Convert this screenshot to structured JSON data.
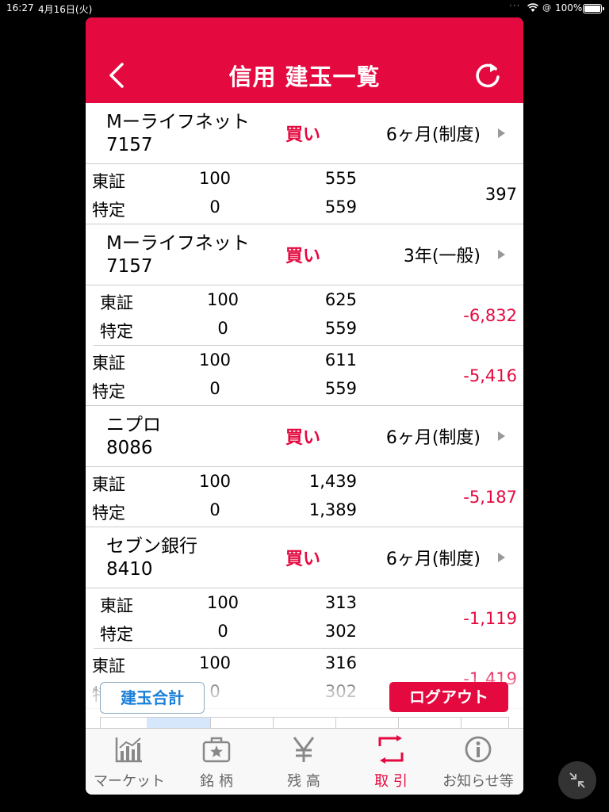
{
  "status_bar": {
    "time": "16:27",
    "date": "4月16日(火)",
    "battery": "100%"
  },
  "header": {
    "title": "信用 建玉一覧"
  },
  "holdings": [
    {
      "name": "Mーライフネット",
      "code": "7157",
      "side": "買い",
      "term": "6ヶ月(制度)",
      "rows": [
        {
          "market": "東証",
          "account": "特定",
          "qty": "100",
          "qty2": "0",
          "price": "555",
          "price2": "559",
          "pl": "397",
          "pl_sign": "pos"
        }
      ]
    },
    {
      "name": "Mーライフネット",
      "code": "7157",
      "side": "買い",
      "term": "3年(一般)",
      "rows": [
        {
          "market": "東証",
          "account": "特定",
          "qty": "100",
          "qty2": "0",
          "price": "625",
          "price2": "559",
          "pl": "-6,832",
          "pl_sign": "neg"
        },
        {
          "market": "東証",
          "account": "特定",
          "qty": "100",
          "qty2": "0",
          "price": "611",
          "price2": "559",
          "pl": "-5,416",
          "pl_sign": "neg"
        }
      ]
    },
    {
      "name": "ニプロ",
      "code": "8086",
      "side": "買い",
      "term": "6ヶ月(制度)",
      "rows": [
        {
          "market": "東証",
          "account": "特定",
          "qty": "100",
          "qty2": "0",
          "price": "1,439",
          "price2": "1,389",
          "pl": "-5,187",
          "pl_sign": "neg"
        }
      ]
    },
    {
      "name": "セブン銀行",
      "code": "8410",
      "side": "買い",
      "term": "6ヶ月(制度)",
      "rows": [
        {
          "market": "東証",
          "account": "特定",
          "qty": "100",
          "qty2": "0",
          "price": "313",
          "price2": "302",
          "pl": "-1,119",
          "pl_sign": "neg"
        },
        {
          "market": "東証",
          "account": "特定",
          "qty": "100",
          "qty2": "0",
          "price": "316",
          "price2": "302",
          "pl": "-1,419",
          "pl_sign": "neg"
        }
      ]
    }
  ],
  "buttons": {
    "total": "建玉合計",
    "logout": "ログアウト"
  },
  "bottom_nav": [
    {
      "label": "マーケット",
      "icon": "chart-icon",
      "active": false
    },
    {
      "label": "銘 柄",
      "icon": "briefcase-star-icon",
      "active": false
    },
    {
      "label": "残 高",
      "icon": "yen-icon",
      "active": false
    },
    {
      "label": "取 引",
      "icon": "trade-icon",
      "active": true
    },
    {
      "label": "お知らせ等",
      "icon": "info-icon",
      "active": false
    }
  ],
  "colors": {
    "accent": "#e4093f",
    "link_blue": "#1a7fd8"
  }
}
